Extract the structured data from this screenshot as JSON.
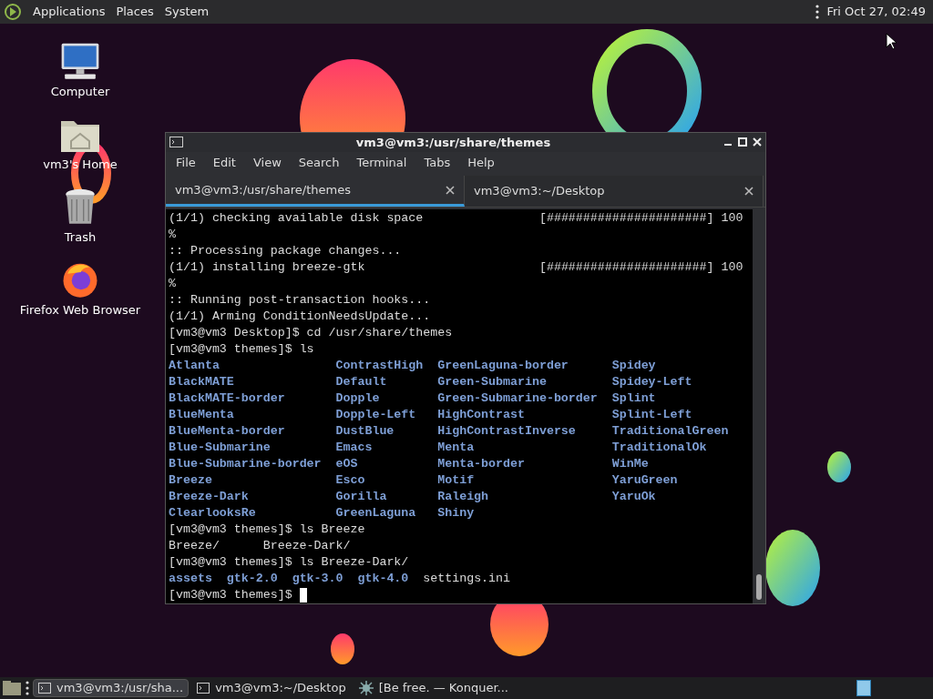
{
  "top_panel": {
    "menus": [
      "Applications",
      "Places",
      "System"
    ],
    "clock": "Fri Oct 27, 02:49"
  },
  "desktop_icons": [
    {
      "kind": "computer",
      "label": "Computer"
    },
    {
      "kind": "home",
      "label": "vm3's Home"
    },
    {
      "kind": "trash",
      "label": "Trash"
    },
    {
      "kind": "browser",
      "label": "Firefox Web Browser"
    }
  ],
  "window": {
    "title": "vm3@vm3:/usr/share/themes",
    "menu": [
      "File",
      "Edit",
      "View",
      "Search",
      "Terminal",
      "Tabs",
      "Help"
    ],
    "tabs": [
      {
        "label": "vm3@vm3:/usr/share/themes",
        "selected": true
      },
      {
        "label": "vm3@vm3:~/Desktop",
        "selected": false
      }
    ],
    "terminal": {
      "lines": [
        {
          "kind": "progress",
          "text": "(1/1) checking available disk space",
          "bar": "[######################] 100"
        },
        {
          "kind": "plain",
          "text": "%"
        },
        {
          "kind": "plain",
          "text": ":: Processing package changes..."
        },
        {
          "kind": "progress",
          "text": "(1/1) installing breeze-gtk",
          "bar": "[######################] 100"
        },
        {
          "kind": "plain",
          "text": "%"
        },
        {
          "kind": "plain",
          "text": ":: Running post-transaction hooks..."
        },
        {
          "kind": "plain",
          "text": "(1/1) Arming ConditionNeedsUpdate..."
        },
        {
          "kind": "plain",
          "text": "[vm3@vm3 Desktop]$ cd /usr/share/themes"
        },
        {
          "kind": "plain",
          "text": "[vm3@vm3 themes]$ ls"
        },
        {
          "kind": "columns",
          "columns": [
            [
              "Atlanta",
              "BlackMATE",
              "BlackMATE-border",
              "BlueMenta",
              "BlueMenta-border",
              "Blue-Submarine",
              "Blue-Submarine-border",
              "Breeze",
              "Breeze-Dark",
              "ClearlooksRe"
            ],
            [
              "ContrastHigh",
              "Default",
              "Dopple",
              "Dopple-Left",
              "DustBlue",
              "Emacs",
              "eOS",
              "Esco",
              "Gorilla",
              "GreenLaguna"
            ],
            [
              "GreenLaguna-border",
              "Green-Submarine",
              "Green-Submarine-border",
              "HighContrast",
              "HighContrastInverse",
              "Menta",
              "Menta-border",
              "Motif",
              "Raleigh",
              "Shiny"
            ],
            [
              "Spidey",
              "Spidey-Left",
              "Splint",
              "Splint-Left",
              "TraditionalGreen",
              "TraditionalOk",
              "WinMe",
              "YaruGreen",
              "YaruOk"
            ]
          ]
        },
        {
          "kind": "plain",
          "text": "[vm3@vm3 themes]$ ls Breeze"
        },
        {
          "kind": "entries",
          "entries": [
            {
              "name": "Breeze/",
              "dir": false
            },
            {
              "name": "Breeze-Dark/",
              "dir": false
            }
          ]
        },
        {
          "kind": "plain",
          "text": "[vm3@vm3 themes]$ ls Breeze-Dark/"
        },
        {
          "kind": "entries",
          "entries": [
            {
              "name": "assets",
              "dir": true
            },
            {
              "name": "gtk-2.0",
              "dir": true
            },
            {
              "name": "gtk-3.0",
              "dir": true
            },
            {
              "name": "gtk-4.0",
              "dir": true
            },
            {
              "name": "settings.ini",
              "dir": false
            }
          ]
        },
        {
          "kind": "prompt",
          "text": "[vm3@vm3 themes]$ "
        }
      ]
    }
  },
  "taskbar": {
    "tasks": [
      {
        "kind": "terminal",
        "label": "vm3@vm3:/usr/sha...",
        "selected": true
      },
      {
        "kind": "terminal",
        "label": "vm3@vm3:~/Desktop",
        "selected": false
      },
      {
        "kind": "browser",
        "label": "[Be free. — Konquer...",
        "selected": false
      }
    ]
  }
}
